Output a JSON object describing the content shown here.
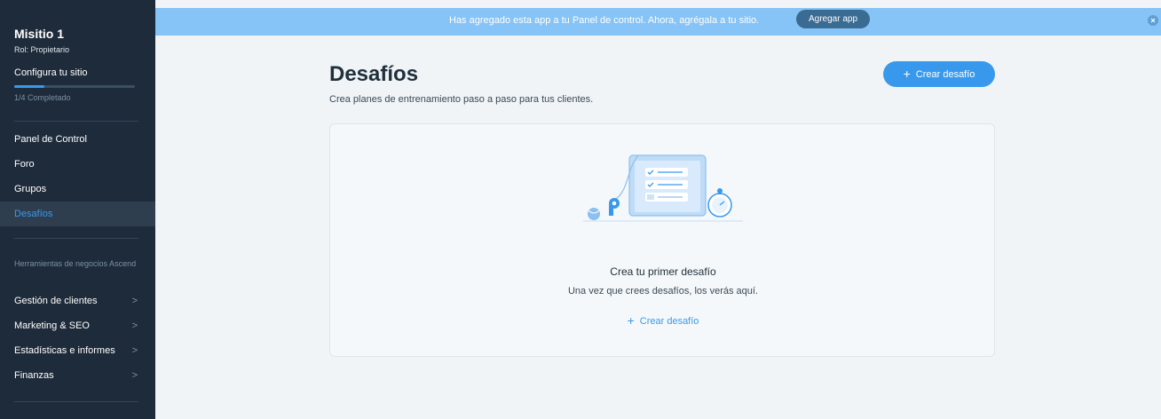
{
  "sidebar": {
    "site_name": "Misitio 1",
    "role": "Rol: Propietario",
    "setup_label": "Configura tu sitio",
    "progress_text": "1/4 Completado",
    "progress_fraction": 0.25,
    "nav": [
      {
        "label": "Panel de Control"
      },
      {
        "label": "Foro"
      },
      {
        "label": "Grupos"
      },
      {
        "label": "Desafíos",
        "active": true
      }
    ],
    "section_label": "Herramientas de negocios Ascend",
    "tools": [
      {
        "label": "Gestión de clientes",
        "chevron": ">"
      },
      {
        "label": "Marketing & SEO",
        "chevron": ">"
      },
      {
        "label": "Estadísticas e informes",
        "chevron": ">"
      },
      {
        "label": "Finanzas",
        "chevron": ">"
      }
    ]
  },
  "banner": {
    "text": "Has agregado esta app a tu Panel de control. Ahora, agrégala a tu sitio.",
    "button": "Agregar app",
    "close_icon": "close-icon"
  },
  "main": {
    "title": "Desafíos",
    "subtitle": "Crea planes de entrenamiento paso a paso para tus clientes.",
    "create_button": "Crear desafío",
    "plus_glyph": "+",
    "empty": {
      "title": "Crea tu primer desafío",
      "description": "Una vez que crees desafíos, los verás aquí.",
      "link": "Crear desafío"
    }
  },
  "colors": {
    "accent": "#3899ec",
    "sidebar_bg": "#1e2b3a",
    "banner_bg": "#86c3f6",
    "page_bg": "#f0f4f7"
  }
}
